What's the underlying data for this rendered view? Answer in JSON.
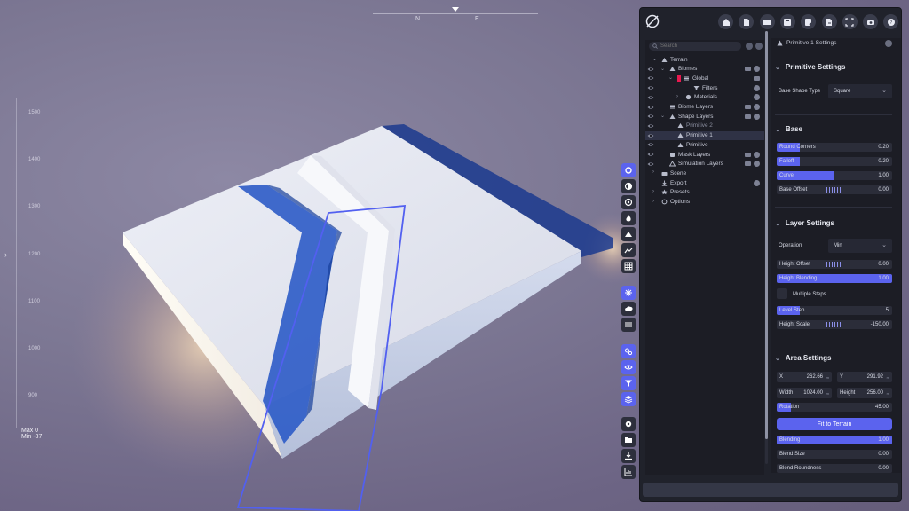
{
  "viewport": {
    "compass": [
      "N",
      "E"
    ],
    "ruler_ticks": [
      "1500",
      "1400",
      "1300",
      "1200",
      "1100",
      "1000",
      "900"
    ],
    "minmax": {
      "max": "Max 0",
      "min": "Min -37"
    },
    "tools": [
      {
        "name": "gear",
        "on": true
      },
      {
        "name": "droplet-half",
        "on": false
      },
      {
        "name": "aperture",
        "on": false
      },
      {
        "name": "flame",
        "on": false
      },
      {
        "name": "mountain",
        "on": false
      },
      {
        "name": "terrain-wave",
        "on": false
      },
      {
        "name": "grid",
        "on": false
      },
      {
        "name": "snowflake",
        "on": true
      },
      {
        "name": "cloud",
        "on": false
      },
      {
        "name": "lines",
        "on": false
      },
      {
        "name": "gears",
        "on": true
      },
      {
        "name": "eye",
        "on": true
      },
      {
        "name": "filter",
        "on": true
      },
      {
        "name": "layers",
        "on": true
      },
      {
        "name": "settings",
        "on": false
      },
      {
        "name": "folder",
        "on": false
      },
      {
        "name": "download",
        "on": false
      },
      {
        "name": "chart",
        "on": false
      }
    ]
  },
  "toolbar": [
    "home-icon",
    "file-icon",
    "folder-icon",
    "save-icon",
    "save-as-icon",
    "export-file-icon",
    "fullscreen-icon",
    "camera-icon",
    "help-icon"
  ],
  "tree": {
    "search_placeholder": "Search",
    "rows": [
      {
        "label": "Terrain",
        "indent": 0,
        "eye": false,
        "caret": "v",
        "icon": "mountain",
        "fold": false,
        "act": false
      },
      {
        "label": "Biomes",
        "indent": 1,
        "eye": true,
        "caret": "v",
        "icon": "mountain",
        "fold": true,
        "act": true
      },
      {
        "label": "Global",
        "indent": 2,
        "eye": true,
        "caret": "v",
        "icon": "stack",
        "fold": false,
        "act": false,
        "chip": true,
        "extra": true
      },
      {
        "label": "Filters",
        "indent": 4,
        "eye": true,
        "caret": "",
        "icon": "filter",
        "fold": false,
        "act": true
      },
      {
        "label": "Materials",
        "indent": 3,
        "eye": true,
        "caret": ">",
        "icon": "sphere",
        "fold": false,
        "act": true
      },
      {
        "label": "Biome Layers",
        "indent": 1,
        "eye": true,
        "caret": "",
        "icon": "stack",
        "fold": true,
        "act": true
      },
      {
        "label": "Shape Layers",
        "indent": 1,
        "eye": true,
        "caret": "v",
        "icon": "mountain",
        "fold": true,
        "act": true
      },
      {
        "label": "Primitive 2",
        "indent": 2,
        "eye": true,
        "caret": "",
        "icon": "triangle",
        "fold": false,
        "act": false,
        "dim": true
      },
      {
        "label": "Primitive 1",
        "indent": 2,
        "eye": true,
        "caret": "",
        "icon": "triangle",
        "fold": false,
        "act": false,
        "sel": true
      },
      {
        "label": "Primitive",
        "indent": 2,
        "eye": true,
        "caret": "",
        "icon": "triangle",
        "fold": false,
        "act": false
      },
      {
        "label": "Mask Layers",
        "indent": 1,
        "eye": true,
        "caret": "",
        "icon": "mask",
        "fold": true,
        "act": true
      },
      {
        "label": "Simulation Layers",
        "indent": 1,
        "eye": true,
        "caret": "",
        "icon": "sim",
        "fold": true,
        "act": true
      },
      {
        "label": "Scene",
        "indent": 0,
        "eye": false,
        "caret": ">",
        "icon": "camera",
        "fold": false,
        "act": false
      },
      {
        "label": "Export",
        "indent": 0,
        "eye": false,
        "caret": "",
        "icon": "download",
        "fold": false,
        "act": true
      },
      {
        "label": "Presets",
        "indent": 0,
        "eye": false,
        "caret": ">",
        "icon": "star",
        "fold": false,
        "act": false
      },
      {
        "label": "Options",
        "indent": 0,
        "eye": false,
        "caret": ">",
        "icon": "gear",
        "fold": false,
        "act": false
      }
    ]
  },
  "settings": {
    "header": "Primitive 1 Settings",
    "primitive": {
      "title": "Primitive Settings",
      "base_shape_label": "Base Shape Type",
      "base_shape_value": "Square"
    },
    "base": {
      "title": "Base",
      "round_corners": {
        "label": "Round Corners",
        "value": "0.20",
        "fill": 0.2
      },
      "falloff": {
        "label": "Falloff",
        "value": "0.20",
        "fill": 0.2
      },
      "curve": {
        "label": "Curve",
        "value": "1.00",
        "fill": 0.5
      },
      "base_offset": {
        "label": "Base Offset",
        "value": "0.00"
      }
    },
    "layer": {
      "title": "Layer Settings",
      "operation_label": "Operation",
      "operation_value": "Min",
      "height_offset": {
        "label": "Height Offset",
        "value": "0.00"
      },
      "height_blending": {
        "label": "Height Blending",
        "value": "1.00",
        "fill": 1.0
      },
      "multiple_steps": "Multiple Steps",
      "level_step": {
        "label": "Level Step",
        "value": "5",
        "fill": 0.2
      },
      "height_scale": {
        "label": "Height Scale",
        "value": "-150.00"
      }
    },
    "area": {
      "title": "Area Settings",
      "x": {
        "label": "X",
        "value": "262.66",
        "unit": "m"
      },
      "y": {
        "label": "Y",
        "value": "291.92",
        "unit": "m"
      },
      "width": {
        "label": "Width",
        "value": "1024.00",
        "unit": "m"
      },
      "height": {
        "label": "Height",
        "value": "256.00",
        "unit": "m"
      },
      "rotation": {
        "label": "Rotation",
        "value": "45.00",
        "fill": 0.125
      },
      "fit_button": "Fit to Terrain",
      "blending": {
        "label": "Blending",
        "value": "1.00",
        "fill": 1.0
      },
      "blend_size": {
        "label": "Blend Size",
        "value": "0.00"
      },
      "blend_roundness": {
        "label": "Blend Roundness",
        "value": "0.00"
      }
    }
  },
  "colors": {
    "accent": "#5b63ee",
    "panel": "#20222b",
    "chip": "#e8194f"
  }
}
